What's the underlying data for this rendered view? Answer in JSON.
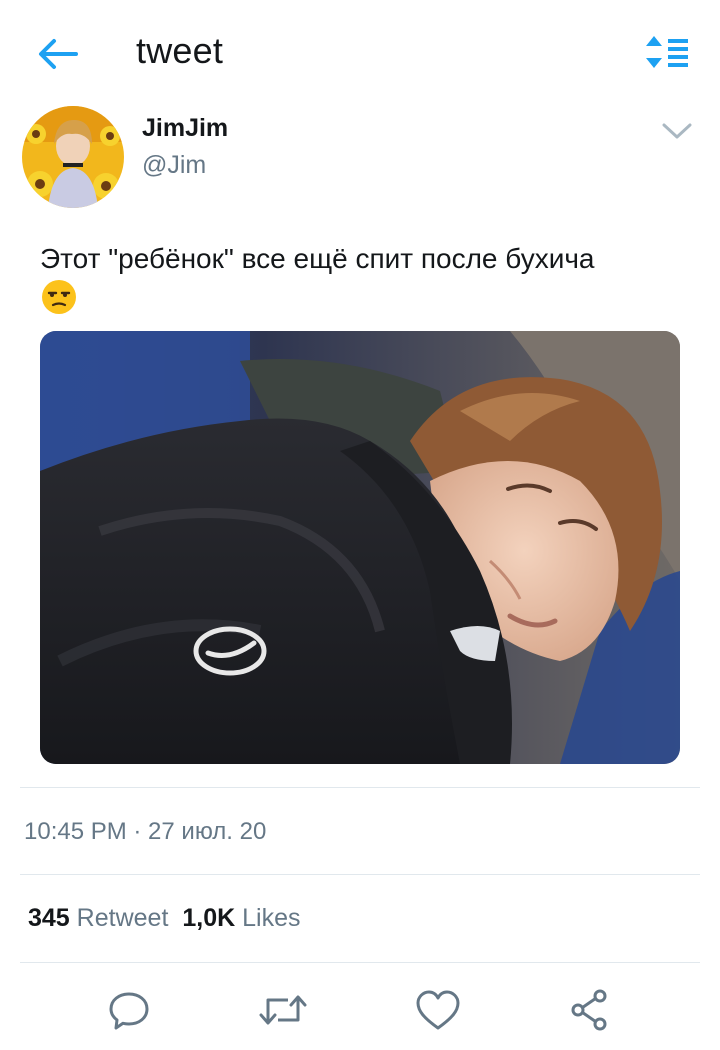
{
  "header": {
    "title": "tweet"
  },
  "user": {
    "name": "JimJim",
    "handle": "@Jim"
  },
  "tweet": {
    "text": "Этот \"ребёнок\" все ещё спит после бухича",
    "emoji": "😒",
    "timestamp": "10:45 PM · 27 июл. 20",
    "retweet_count": "345",
    "retweet_label": "Retweet",
    "likes_count": "1,0K",
    "likes_label": "Likes"
  },
  "colors": {
    "accent": "#1DA1F2",
    "text": "#14171A",
    "secondary": "#657786",
    "divider": "#E1E8ED"
  },
  "icons": [
    "back-arrow-icon",
    "sort-icon",
    "chevron-down-icon",
    "reply-icon",
    "retweet-icon",
    "like-icon",
    "share-icon"
  ]
}
